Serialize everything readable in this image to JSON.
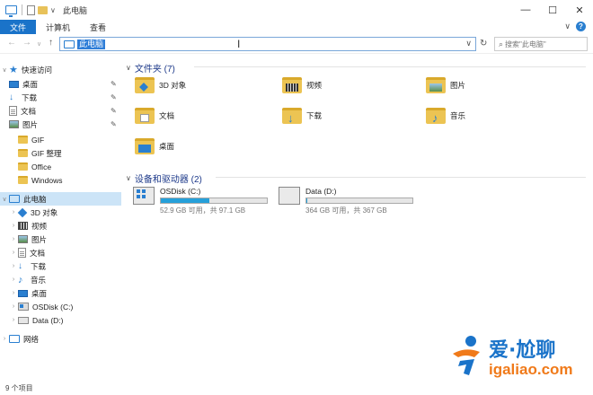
{
  "window": {
    "title": "此电脑",
    "controls": {
      "minimize": "—",
      "maximize": "☐",
      "close": "✕"
    }
  },
  "ribbon": {
    "tabs": [
      "文件",
      "计算机",
      "查看"
    ],
    "expand": "∨"
  },
  "navbar": {
    "back": "←",
    "forward": "→",
    "recent": "∨",
    "up": "↑",
    "address": "此电脑",
    "dropdown": "∨",
    "refresh": "↻",
    "search_placeholder": "搜索\"此电脑\""
  },
  "sidebar": {
    "quick_access": {
      "label": "快速访问",
      "items": [
        {
          "label": "桌面",
          "icon": "desktop-icon",
          "pinned": true
        },
        {
          "label": "下载",
          "icon": "download-icon",
          "pinned": true
        },
        {
          "label": "文档",
          "icon": "document-icon",
          "pinned": true
        },
        {
          "label": "图片",
          "icon": "pictures-icon",
          "pinned": true
        },
        {
          "label": "GIF",
          "icon": "folder-icon",
          "pinned": false
        },
        {
          "label": "GIF 整理",
          "icon": "folder-icon",
          "pinned": false
        },
        {
          "label": "Office",
          "icon": "folder-icon",
          "pinned": false
        },
        {
          "label": "Windows",
          "icon": "folder-icon",
          "pinned": false
        }
      ]
    },
    "this_pc": {
      "label": "此电脑",
      "items": [
        {
          "label": "3D 对象",
          "icon": "3d-objects-icon"
        },
        {
          "label": "视频",
          "icon": "videos-icon"
        },
        {
          "label": "图片",
          "icon": "pictures-icon"
        },
        {
          "label": "文档",
          "icon": "document-icon"
        },
        {
          "label": "下载",
          "icon": "download-icon"
        },
        {
          "label": "音乐",
          "icon": "music-icon"
        },
        {
          "label": "桌面",
          "icon": "desktop-icon"
        },
        {
          "label": "OSDisk (C:)",
          "icon": "os-drive-icon"
        },
        {
          "label": "Data (D:)",
          "icon": "drive-icon"
        }
      ]
    },
    "network": {
      "label": "网络",
      "icon": "network-icon"
    }
  },
  "content": {
    "folders_header": "文件夹 (7)",
    "folders": [
      {
        "label": "3D 对象",
        "icon": "3d-objects-folder-icon"
      },
      {
        "label": "视频",
        "icon": "videos-folder-icon"
      },
      {
        "label": "图片",
        "icon": "pictures-folder-icon"
      },
      {
        "label": "文档",
        "icon": "documents-folder-icon"
      },
      {
        "label": "下载",
        "icon": "downloads-folder-icon"
      },
      {
        "label": "音乐",
        "icon": "music-folder-icon"
      },
      {
        "label": "桌面",
        "icon": "desktop-folder-icon"
      }
    ],
    "drives_header": "设备和驱动器 (2)",
    "drives": [
      {
        "name": "OSDisk (C:)",
        "free": "52.9 GB 可用，共 97.1 GB",
        "used_fraction": 0.46,
        "icon": "os-drive-icon"
      },
      {
        "name": "Data (D:)",
        "free": "364 GB 可用，共 367 GB",
        "used_fraction": 0.01,
        "icon": "drive-icon"
      }
    ]
  },
  "status": {
    "items": "9 个项目"
  },
  "watermark": {
    "name": "爱·尬聊",
    "url": "igaliao.com"
  },
  "colors": {
    "accent": "#1a73c9",
    "selection": "#cce4f7",
    "folder": "#ecc453",
    "drive_bar": "#26a0da",
    "watermark_orange": "#f07a1a"
  }
}
